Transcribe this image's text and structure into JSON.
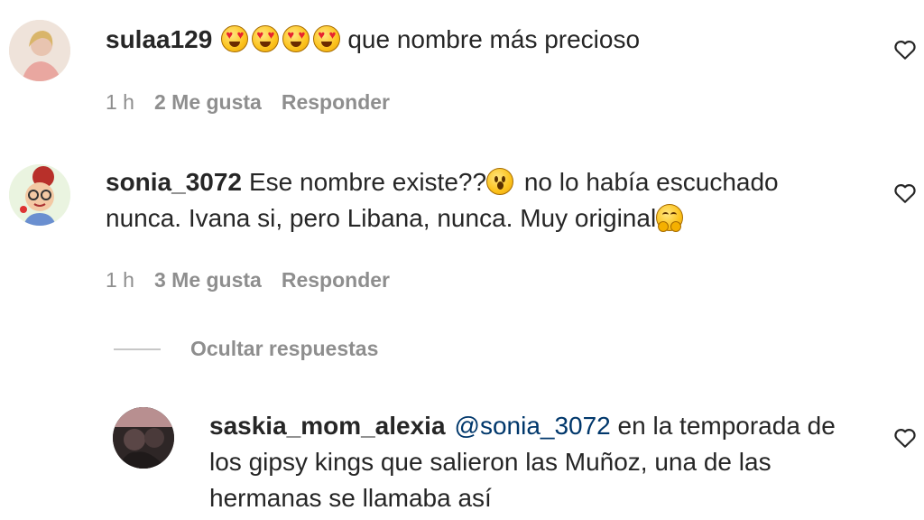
{
  "comments": [
    {
      "username": "sulaa129",
      "text": "que nombre más precioso",
      "emojis": [
        "heart-eyes",
        "heart-eyes",
        "heart-eyes",
        "heart-eyes"
      ],
      "time": "1 h",
      "likes": "2 Me gusta",
      "reply": "Responder"
    },
    {
      "username": "sonia_3072",
      "text_part1": "Ese nombre existe??",
      "text_part2": " no lo había escuchado",
      "text_line2": "nunca. Ivana si, pero Libana, nunca. Muy original",
      "emojis": [
        "surprised",
        "hug"
      ],
      "time": "1 h",
      "likes": "3 Me gusta",
      "reply": "Responder"
    }
  ],
  "hide_replies": "Ocultar respuestas",
  "reply_comment": {
    "username": "saskia_mom_alexia",
    "mention": "@sonia_3072",
    "text_line1": " en la temporada de",
    "text_line2": "los gipsy kings que salieron las Muñoz, una de las",
    "text_line3": "hermanas se llamaba así"
  },
  "colors": {
    "text": "#262626",
    "secondary": "#8e8e8e",
    "mention": "#00376b"
  },
  "icons": [
    "heart-outline-icon"
  ]
}
